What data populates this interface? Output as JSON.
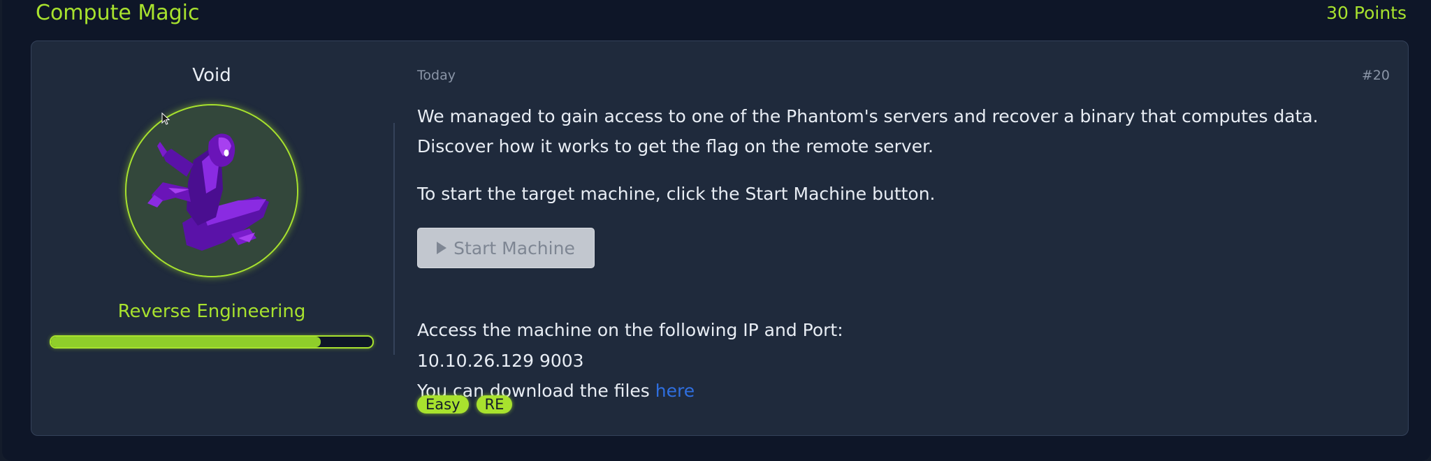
{
  "challenge": {
    "title": "Compute Magic",
    "points": "30 Points"
  },
  "post": {
    "author": "Void",
    "category": "Reverse Engineering",
    "progress": 0.84,
    "date": "Today",
    "number": "#20",
    "description": "We managed to gain access to one of the Phantom's servers and recover a binary that computes data. Discover how it works to get the flag on the remote server.",
    "start_instructions": "To start the target machine, click the Start Machine button.",
    "start_button": {
      "label": "Start Machine",
      "icon": "play-icon",
      "disabled": true
    },
    "access_text": "Access the machine on the following IP and Port:",
    "ip_port": "10.10.26.129 9003",
    "download_text": "You can download the files ",
    "download_link": "here",
    "tags": [
      "Easy",
      "RE"
    ]
  },
  "colors": {
    "accent": "#a8e22e",
    "background": "#0e1628",
    "card": "#1f2a3c",
    "link": "#2f6fe0",
    "avatar_figure": "#7a1ccc"
  }
}
